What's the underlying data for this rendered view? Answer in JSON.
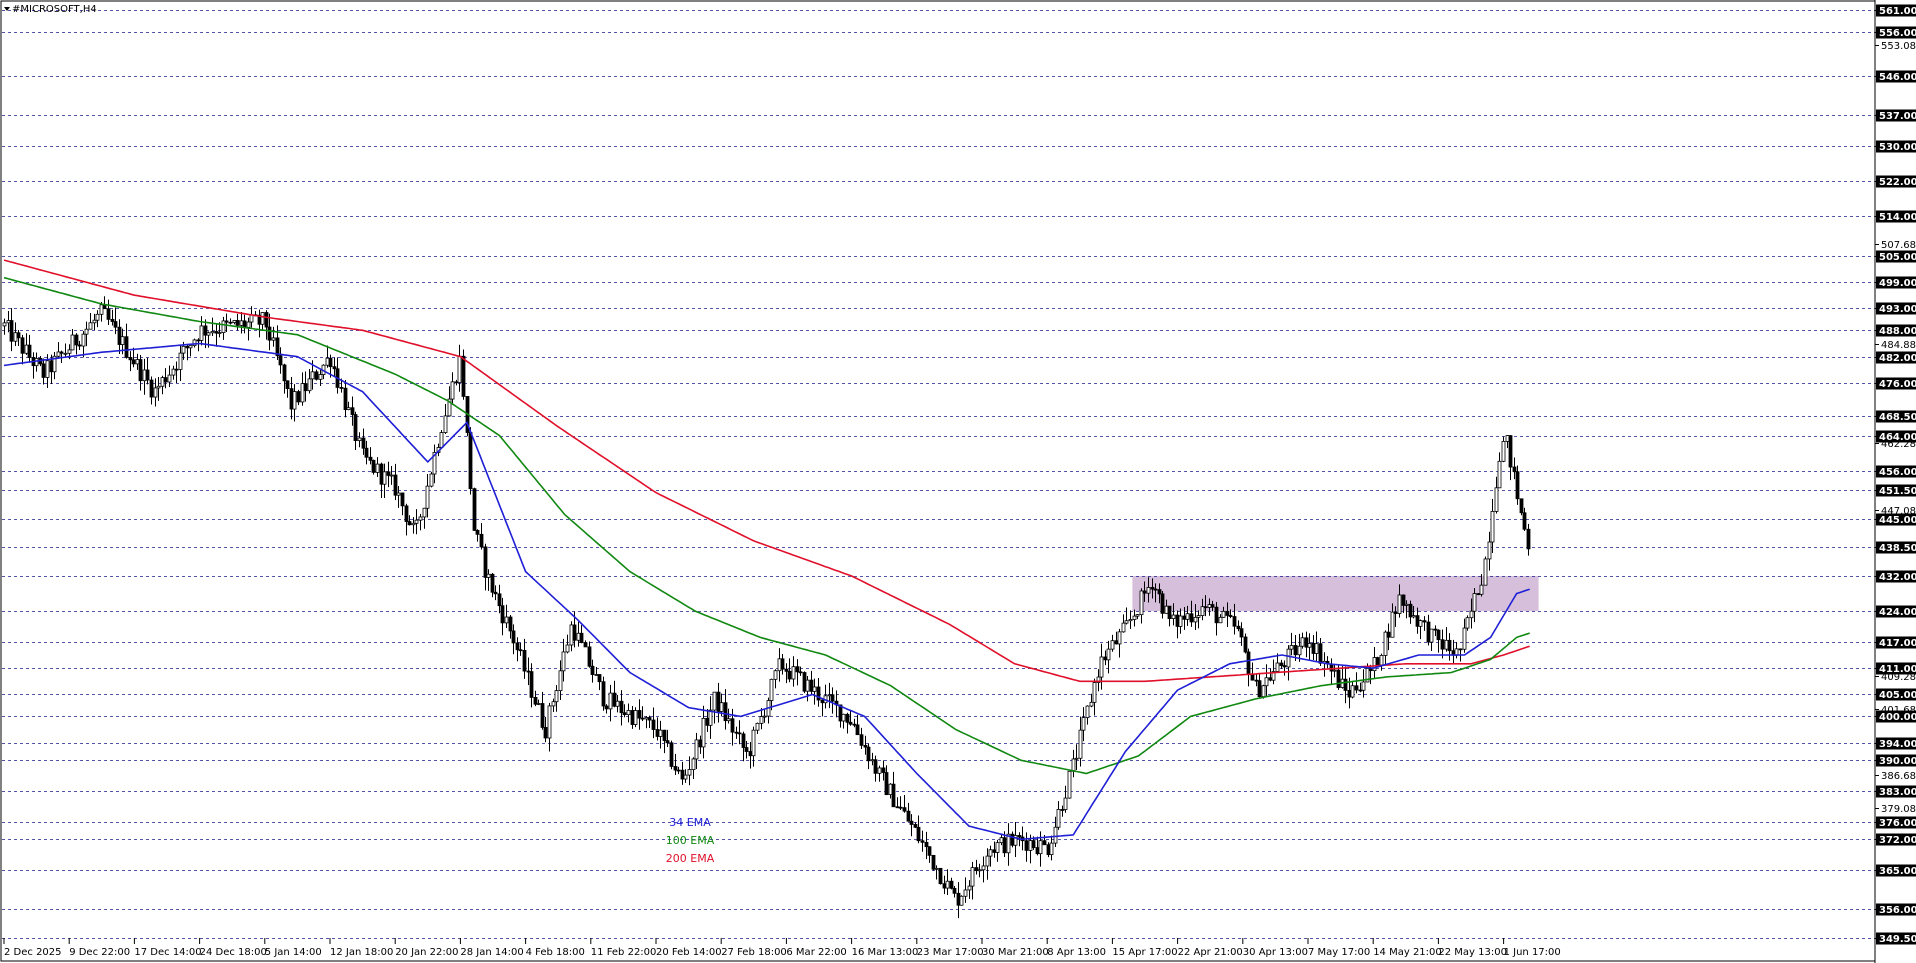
{
  "window": {
    "symbol_title": "#MICROSOFT,H4",
    "menu_icon": "triangle-down-icon"
  },
  "colors": {
    "background": "#ffffff",
    "grid": "#1a1a8c",
    "candle": "#000000",
    "ema34": "#1f1fd6",
    "ema100": "#118811",
    "ema200": "#e0102a",
    "zone": "#d5bfdb",
    "level_label_bg": "#000000"
  },
  "chart_data": {
    "type": "candlestick",
    "title": "#MICROSOFT,H4",
    "ylim": [
      349.5,
      563.5
    ],
    "y_axis_side": "right",
    "grid": true,
    "x_tick_labels": [
      "2 Dec 2025",
      "9 Dec 22:00",
      "17 Dec 14:00",
      "24 Dec 18:00",
      "5 Jan 14:00",
      "12 Jan 18:00",
      "20 Jan 22:00",
      "28 Jan 14:00",
      "4 Feb 18:00",
      "11 Feb 22:00",
      "20 Feb 14:00",
      "27 Feb 18:00",
      "6 Mar 22:00",
      "16 Mar 13:00",
      "23 Mar 17:00",
      "30 Mar 21:00",
      "8 Apr 13:00",
      "15 Apr 17:00",
      "22 Apr 21:00",
      "30 Apr 13:00",
      "7 May 17:00",
      "14 May 21:00",
      "22 May 13:00",
      "1 Jun 17:00"
    ],
    "level_lines": [
      561.0,
      556.0,
      546.0,
      537.0,
      530.0,
      522.0,
      514.0,
      505.0,
      499.0,
      493.0,
      488.0,
      482.0,
      476.0,
      468.5,
      464.0,
      456.0,
      451.5,
      445.0,
      438.5,
      432.0,
      424.0,
      417.0,
      411.0,
      405.0,
      400.0,
      394.0,
      390.0,
      383.0,
      376.0,
      372.0,
      365.0,
      356.0,
      349.5
    ],
    "level_labels": [
      "561.00",
      "556.00",
      "546.00",
      "537.00",
      "530.00",
      "522.00",
      "514.00",
      "505.00",
      "499.00",
      "493.00",
      "488.00",
      "482.00",
      "476.00",
      "468.50",
      "464.00",
      "456.00",
      "451.50",
      "445.00",
      "438.50",
      "432.00",
      "424.00",
      "417.00",
      "411.00",
      "405.00",
      "400.00",
      "394.00",
      "390.00",
      "383.00",
      "376.00",
      "372.00",
      "365.00",
      "356.00",
      "349.50"
    ],
    "scale_ticks": [
      553.08,
      507.68,
      484.88,
      462.28,
      447.08,
      409.28,
      401.68,
      386.68,
      379.08
    ],
    "scale_tick_labels": [
      "553.08",
      "507.68",
      "484.88",
      "462.28",
      "447.08",
      "409.28",
      "401.68",
      "386.68",
      "379.08"
    ],
    "zone": {
      "x_from": "15 Apr 17:00",
      "x_to": "1 Jun 17:00",
      "price_low": 424.0,
      "price_high": 432.0
    },
    "legend": [
      {
        "name": "34 EMA",
        "color": "#1f1fd6"
      },
      {
        "name": "100 EMA",
        "color": "#118811"
      },
      {
        "name": "200 EMA",
        "color": "#e0102a"
      }
    ],
    "close_anchors": [
      {
        "t": 0.0,
        "p": 489
      },
      {
        "t": 0.6,
        "p": 478
      },
      {
        "t": 1.5,
        "p": 492
      },
      {
        "t": 2.3,
        "p": 474
      },
      {
        "t": 3.0,
        "p": 488
      },
      {
        "t": 4.0,
        "p": 490
      },
      {
        "t": 4.4,
        "p": 471
      },
      {
        "t": 5.0,
        "p": 482
      },
      {
        "t": 5.5,
        "p": 459
      },
      {
        "t": 6.0,
        "p": 452
      },
      {
        "t": 6.3,
        "p": 441
      },
      {
        "t": 6.7,
        "p": 466
      },
      {
        "t": 7.0,
        "p": 482
      },
      {
        "t": 7.2,
        "p": 443
      },
      {
        "t": 7.4,
        "p": 432
      },
      {
        "t": 7.8,
        "p": 418
      },
      {
        "t": 8.3,
        "p": 397
      },
      {
        "t": 8.7,
        "p": 421
      },
      {
        "t": 9.2,
        "p": 404
      },
      {
        "t": 10.0,
        "p": 397
      },
      {
        "t": 10.4,
        "p": 385
      },
      {
        "t": 10.9,
        "p": 404
      },
      {
        "t": 11.4,
        "p": 391
      },
      {
        "t": 11.9,
        "p": 412
      },
      {
        "t": 12.4,
        "p": 406
      },
      {
        "t": 13.0,
        "p": 399
      },
      {
        "t": 13.4,
        "p": 387
      },
      {
        "t": 14.0,
        "p": 373
      },
      {
        "t": 14.6,
        "p": 358
      },
      {
        "t": 15.1,
        "p": 370
      },
      {
        "t": 15.6,
        "p": 372
      },
      {
        "t": 16.0,
        "p": 370
      },
      {
        "t": 16.4,
        "p": 389
      },
      {
        "t": 16.8,
        "p": 412
      },
      {
        "t": 17.2,
        "p": 420
      },
      {
        "t": 17.6,
        "p": 431
      },
      {
        "t": 17.9,
        "p": 421
      },
      {
        "t": 18.4,
        "p": 425
      },
      {
        "t": 18.9,
        "p": 420
      },
      {
        "t": 19.2,
        "p": 406
      },
      {
        "t": 19.6,
        "p": 412
      },
      {
        "t": 20.0,
        "p": 418
      },
      {
        "t": 20.6,
        "p": 405
      },
      {
        "t": 21.0,
        "p": 411
      },
      {
        "t": 21.4,
        "p": 427
      },
      {
        "t": 21.9,
        "p": 418
      },
      {
        "t": 22.3,
        "p": 414
      },
      {
        "t": 22.7,
        "p": 434
      },
      {
        "t": 22.95,
        "p": 462
      },
      {
        "t": 23.05,
        "p": 462
      },
      {
        "t": 23.25,
        "p": 447
      },
      {
        "t": 23.4,
        "p": 438
      }
    ],
    "ema34_anchors": [
      {
        "t": 0.0,
        "p": 480
      },
      {
        "t": 1.5,
        "p": 483
      },
      {
        "t": 3.0,
        "p": 485
      },
      {
        "t": 4.5,
        "p": 482
      },
      {
        "t": 5.5,
        "p": 474
      },
      {
        "t": 6.5,
        "p": 458
      },
      {
        "t": 7.1,
        "p": 467
      },
      {
        "t": 8.0,
        "p": 433
      },
      {
        "t": 8.8,
        "p": 422
      },
      {
        "t": 9.6,
        "p": 410
      },
      {
        "t": 10.5,
        "p": 402
      },
      {
        "t": 11.3,
        "p": 400
      },
      {
        "t": 12.4,
        "p": 405
      },
      {
        "t": 13.2,
        "p": 400
      },
      {
        "t": 14.0,
        "p": 387
      },
      {
        "t": 14.8,
        "p": 375
      },
      {
        "t": 15.6,
        "p": 372
      },
      {
        "t": 16.4,
        "p": 373
      },
      {
        "t": 17.2,
        "p": 392
      },
      {
        "t": 18.0,
        "p": 406
      },
      {
        "t": 18.8,
        "p": 412
      },
      {
        "t": 19.6,
        "p": 414
      },
      {
        "t": 20.3,
        "p": 412
      },
      {
        "t": 21.0,
        "p": 411
      },
      {
        "t": 21.7,
        "p": 414
      },
      {
        "t": 22.4,
        "p": 414
      },
      {
        "t": 22.8,
        "p": 418
      },
      {
        "t": 23.2,
        "p": 428
      },
      {
        "t": 23.4,
        "p": 429
      }
    ],
    "ema100_anchors": [
      {
        "t": 0.0,
        "p": 500
      },
      {
        "t": 1.5,
        "p": 494
      },
      {
        "t": 3.0,
        "p": 490
      },
      {
        "t": 4.5,
        "p": 487
      },
      {
        "t": 6.0,
        "p": 478
      },
      {
        "t": 6.8,
        "p": 472
      },
      {
        "t": 7.6,
        "p": 464
      },
      {
        "t": 8.6,
        "p": 446
      },
      {
        "t": 9.6,
        "p": 433
      },
      {
        "t": 10.6,
        "p": 424
      },
      {
        "t": 11.6,
        "p": 418
      },
      {
        "t": 12.6,
        "p": 414
      },
      {
        "t": 13.6,
        "p": 407
      },
      {
        "t": 14.6,
        "p": 397
      },
      {
        "t": 15.6,
        "p": 390
      },
      {
        "t": 16.6,
        "p": 387
      },
      {
        "t": 17.4,
        "p": 391
      },
      {
        "t": 18.2,
        "p": 400
      },
      {
        "t": 19.2,
        "p": 404
      },
      {
        "t": 20.2,
        "p": 407
      },
      {
        "t": 21.2,
        "p": 409
      },
      {
        "t": 22.2,
        "p": 410
      },
      {
        "t": 22.8,
        "p": 413
      },
      {
        "t": 23.2,
        "p": 418
      },
      {
        "t": 23.4,
        "p": 419
      }
    ],
    "ema200_anchors": [
      {
        "t": 0.0,
        "p": 504
      },
      {
        "t": 2.0,
        "p": 496
      },
      {
        "t": 4.0,
        "p": 491
      },
      {
        "t": 5.5,
        "p": 488
      },
      {
        "t": 7.0,
        "p": 482
      },
      {
        "t": 8.5,
        "p": 466
      },
      {
        "t": 10.0,
        "p": 451
      },
      {
        "t": 11.5,
        "p": 440
      },
      {
        "t": 13.0,
        "p": 432
      },
      {
        "t": 14.5,
        "p": 421
      },
      {
        "t": 15.5,
        "p": 412
      },
      {
        "t": 16.5,
        "p": 408
      },
      {
        "t": 17.5,
        "p": 408
      },
      {
        "t": 18.5,
        "p": 409
      },
      {
        "t": 19.5,
        "p": 410
      },
      {
        "t": 20.5,
        "p": 411
      },
      {
        "t": 21.5,
        "p": 412
      },
      {
        "t": 22.5,
        "p": 412
      },
      {
        "t": 23.0,
        "p": 414
      },
      {
        "t": 23.4,
        "p": 416
      }
    ]
  }
}
